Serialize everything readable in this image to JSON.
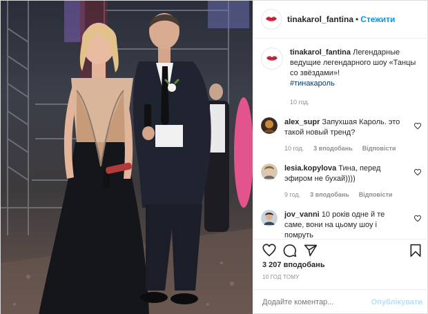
{
  "header": {
    "username": "tinakarol_fantina",
    "separator": "•",
    "follow_label": "Стежити"
  },
  "caption": {
    "username": "tinakarol_fantina",
    "text": "Легендарные ведущие легендарного шоу «Танцы со звёздами»!",
    "hashtag": "#тинакароль",
    "time": "10 год."
  },
  "comments": [
    {
      "username": "alex_supr",
      "text": "Запухшая Кароль. это такой новый тренд?",
      "time": "10 год.",
      "likes": "3 вподобань",
      "reply": "Відповісти"
    },
    {
      "username": "lesia.kopylova",
      "text": "Тина, перед эфиром не бухай))))",
      "time": "9 год.",
      "likes": "3 вподобань",
      "reply": "Відповісти"
    },
    {
      "username": "jov_vanni",
      "text": "10 років одне й те саме, вони на цьому шоу і помруть"
    }
  ],
  "stats": {
    "likes": "3 207 вподобань",
    "time": "10 ГОД ТОМУ"
  },
  "add_comment": {
    "placeholder": "Додайте коментар...",
    "publish_label": "Опублікувати"
  },
  "icons": {
    "like": "heart-icon",
    "comment": "comment-icon",
    "share": "share-icon",
    "save": "bookmark-icon"
  },
  "colors": {
    "accent": "#0095f6",
    "publish_disabled": "#b2dffc",
    "muted": "#8e8e8e",
    "brand_lips": "#d32b3f"
  }
}
